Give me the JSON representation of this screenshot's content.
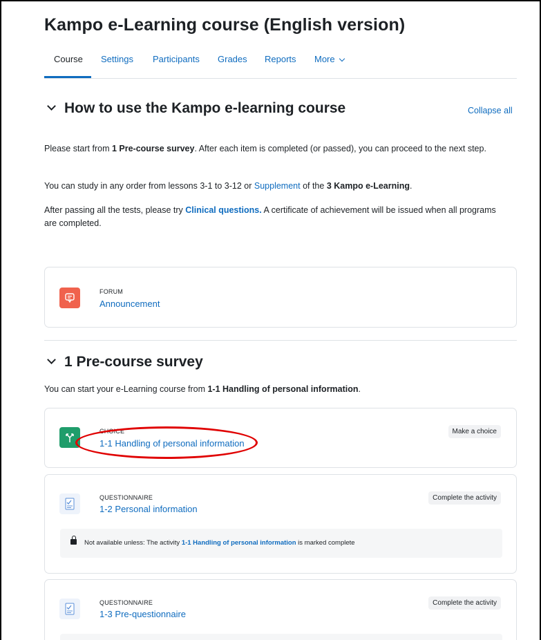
{
  "page": {
    "title": "Kampo e-Learning course (English version)"
  },
  "nav": {
    "tabs": [
      {
        "label": "Course",
        "active": true
      },
      {
        "label": "Settings"
      },
      {
        "label": "Participants"
      },
      {
        "label": "Grades"
      },
      {
        "label": "Reports"
      },
      {
        "label": "More"
      }
    ]
  },
  "section_intro": {
    "title": "How to use the Kampo e-learning course",
    "collapse_all": "Collapse all",
    "p1": {
      "a": "Please start from ",
      "b": "1 Pre-course survey",
      "c": ". After each item is completed (or passed), you can proceed to the next step."
    },
    "p2": {
      "a": "You can study in any order from lessons 3-1 to 3-12 or ",
      "link": "Supplement",
      "c": " of the ",
      "b": "3 Kampo e-Learning",
      "d": "."
    },
    "p3": {
      "a": "After passing all the tests, please try ",
      "link": "Clinical questions.",
      "c": " A certificate of achievement will be issued when all programs are completed."
    }
  },
  "forum": {
    "type": "FORUM",
    "name": "Announcement"
  },
  "section_survey": {
    "title": "1 Pre-course survey",
    "intro": {
      "a": "You can start your e-Learning course from ",
      "b": "1-1 Handling of personal information",
      "c": "."
    },
    "activities": [
      {
        "type": "CHOICE",
        "name": "1-1 Handling of personal information",
        "badge": "Make a choice"
      },
      {
        "type": "QUESTIONNAIRE",
        "name": "1-2 Personal information",
        "badge": "Complete the activity",
        "restriction": {
          "a": "Not available unless: The activity ",
          "b": "1-1 Handling of personal information",
          "c": " is marked complete"
        }
      },
      {
        "type": "QUESTIONNAIRE",
        "name": "1-3 Pre-questionnaire",
        "badge": "Complete the activity"
      }
    ]
  },
  "colors": {
    "link": "#0f6cbf",
    "forum_icon": "#f0624d",
    "choice_icon": "#1f9d6b",
    "annotation": "#e00000"
  },
  "icons": {
    "forum": "forum-icon",
    "choice": "choice-icon",
    "questionnaire": "questionnaire-icon",
    "lock": "lock-icon",
    "chevron": "chevron-down-icon"
  }
}
